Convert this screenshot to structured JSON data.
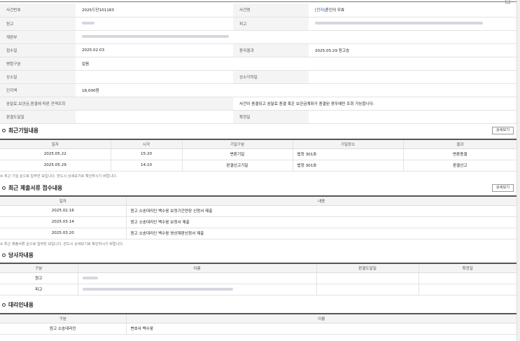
{
  "case_info": {
    "rows": [
      {
        "l1": "사건번호",
        "v1": "2025드단101183",
        "l2": "사건명",
        "v2_tag": "[전자]",
        "v2": "혼인의 무효"
      },
      {
        "l1": "원고",
        "v1": "",
        "l2": "피고",
        "v2": ""
      },
      {
        "l1": "재판부",
        "v1": "",
        "l2": "",
        "v2": ""
      },
      {
        "l1": "접수일",
        "v1": "2025.02.03",
        "l2": "종국결과",
        "v2": "2025.05.29 원고승"
      },
      {
        "l1": "병합구분",
        "v1": "없음",
        "l2": "",
        "v2": ""
      },
      {
        "l1": "상소일",
        "v1": "",
        "l2": "상소각하일",
        "v2": ""
      },
      {
        "l1": "인지액",
        "v1": "18,000원",
        "l2": "",
        "v2": ""
      },
      {
        "l1": "송달료,보관금,종결에 따른 잔액조회",
        "v1": "",
        "l2": "",
        "v2": "사건이 종결되고 송달료 종결 혹은 보관금계좌가 종결된 경우에만 조회 가능합니다."
      },
      {
        "l1": "판결도달일",
        "v1": "",
        "l2": "확정일",
        "v2": ""
      }
    ]
  },
  "hearings": {
    "title": "최근기일내용",
    "detail_button": "상세보기",
    "headers": [
      "일자",
      "시각",
      "기일구분",
      "기일장소",
      "결과"
    ],
    "rows": [
      [
        "2025.05.22",
        "15:20",
        "변론기일",
        "법정 301호",
        "변론종결"
      ],
      [
        "2025.05.29",
        "14:10",
        "판결선고기일",
        "법정 301호",
        "판결선고"
      ]
    ],
    "note": "※ 최근 기일 순으로 일부만 보입니다. 반드시 상세보기로 확인하시기 바랍니다."
  },
  "filings": {
    "title": "최근 제출서류 접수내용",
    "detail_button": "상세보기",
    "headers": [
      "일자",
      "내용"
    ],
    "rows": [
      [
        "2025.02.16",
        "원고 소송대리인 백수웅 보정기간연장 신청서 제출"
      ],
      [
        "2025.03.14",
        "원고 소송대리인 백수웅 보정서 제출"
      ],
      [
        "2025.03.20",
        "원고 소송대리인 백수웅 영상재판신청서 제출"
      ]
    ],
    "note": "※ 최근 제출서류 순으로 일부만 보입니다. 반드시 상세보기로 확인하시기 바랍니다."
  },
  "parties": {
    "title": "당사자내용",
    "headers": [
      "구분",
      "이름",
      "판결도달일",
      "확정일"
    ],
    "rows": [
      [
        "원고",
        "",
        "",
        ""
      ],
      [
        "피고",
        "",
        "",
        ""
      ]
    ]
  },
  "representatives": {
    "title": "대리인내용",
    "headers": [
      "구분",
      "이름"
    ],
    "rows": [
      [
        "원고 소송대리인",
        "변호사 백수웅"
      ]
    ]
  },
  "colors": {
    "link": "#2a4ea0",
    "header_bg": "#f4f4f4",
    "border": "#e3e3e3",
    "redacted": "#cfd3da"
  }
}
